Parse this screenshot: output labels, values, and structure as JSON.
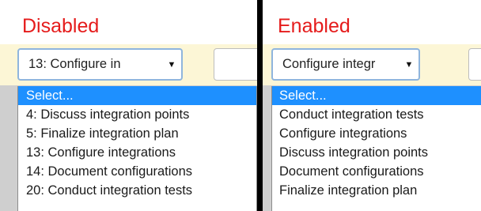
{
  "panels": [
    {
      "heading": "Disabled",
      "select_value": "13: Configure in",
      "options": [
        "Select...",
        "4: Discuss integration points",
        "5: Finalize integration plan",
        "13: Configure integrations",
        "14: Document configurations",
        "20: Conduct integration tests"
      ],
      "highlighted_option": "Select..."
    },
    {
      "heading": "Enabled",
      "select_value": "Configure integr",
      "options": [
        "Select...",
        "Conduct integration tests",
        "Configure integrations",
        "Discuss integration points",
        "Document configurations",
        "Finalize integration plan"
      ],
      "highlighted_option": "Select..."
    }
  ],
  "icons": {
    "dropdown_arrow": "▼"
  },
  "colors": {
    "heading": "#e51b1b",
    "band": "#fcf6d6",
    "select_border": "#8fb5dd",
    "highlight": "#1e90ff",
    "divider": "#000000"
  }
}
